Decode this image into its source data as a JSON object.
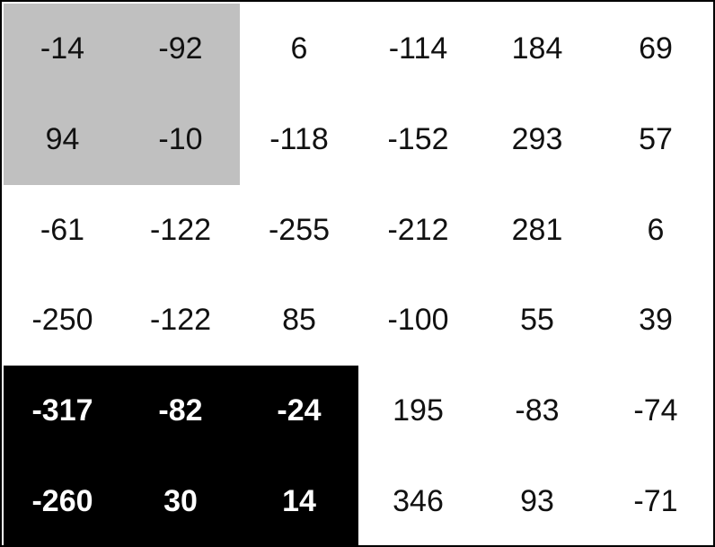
{
  "matrix": {
    "rows": [
      [
        "-14",
        "-92",
        "6",
        "-114",
        "184",
        "69"
      ],
      [
        "94",
        "-10",
        "-118",
        "-152",
        "293",
        "57"
      ],
      [
        "-61",
        "-122",
        "-255",
        "-212",
        "281",
        "6"
      ],
      [
        "-250",
        "-122",
        "85",
        "-100",
        "55",
        "39"
      ],
      [
        "-317",
        "-82",
        "-24",
        "195",
        "-83",
        "-74"
      ],
      [
        "-260",
        "30",
        "14",
        "346",
        "93",
        "-71"
      ]
    ],
    "highlight_colors": {
      "gray_block": "#c0c0c0",
      "black_block": "#000000",
      "black_block_text": "#ffffff"
    }
  }
}
